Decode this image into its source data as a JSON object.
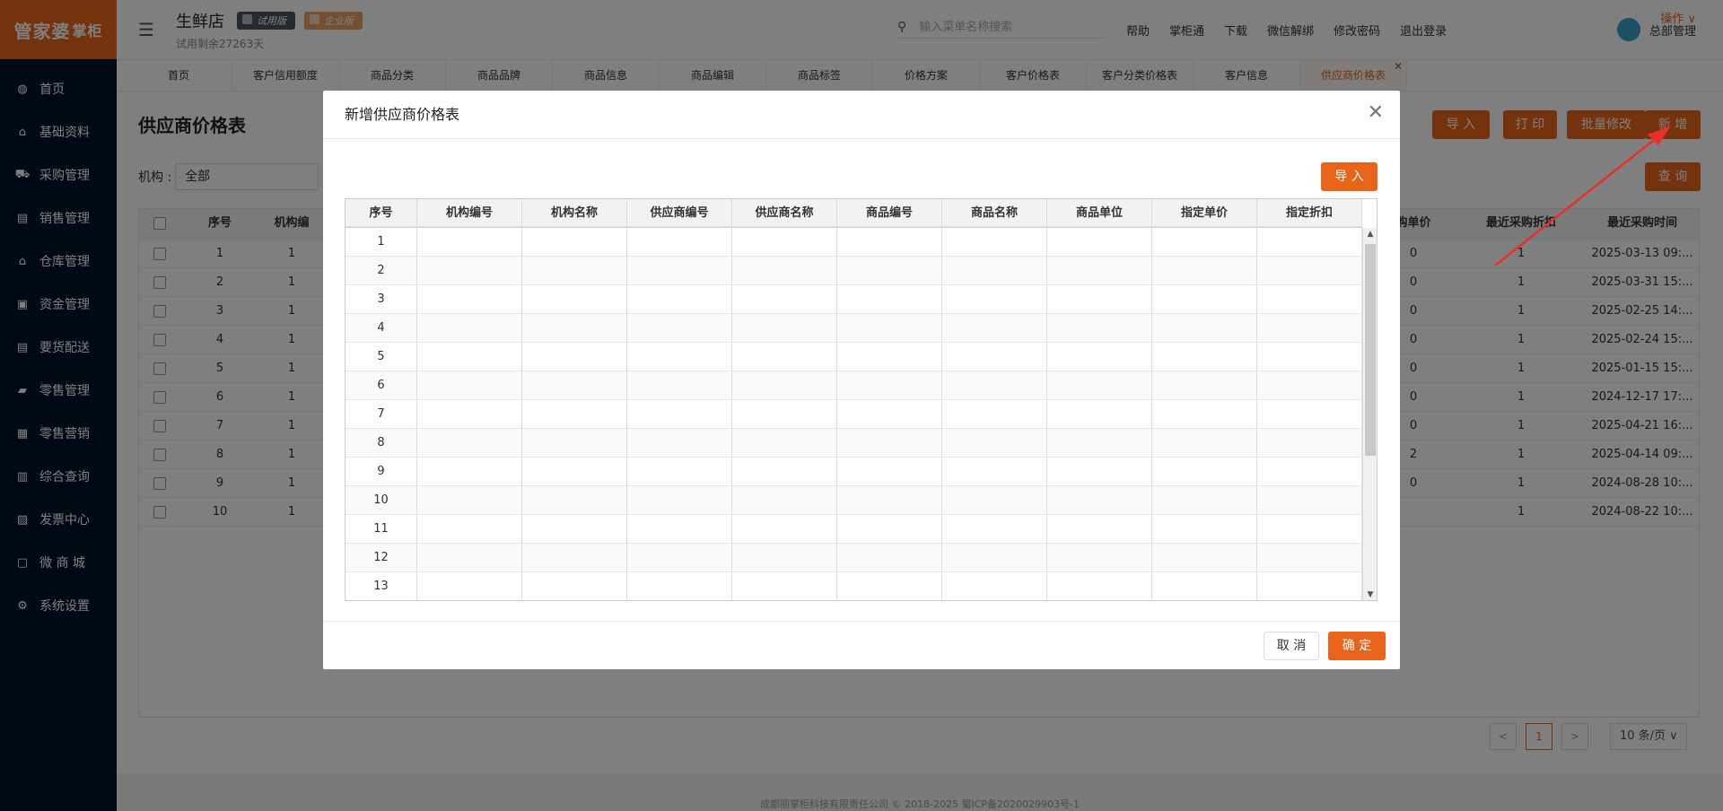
{
  "logo": {
    "main": "管家婆",
    "sub": "掌柜"
  },
  "sidebar": {
    "items": [
      {
        "label": "首页",
        "icon": "globe-icon"
      },
      {
        "label": "基础资料",
        "icon": "home-icon"
      },
      {
        "label": "采购管理",
        "icon": "cart-icon"
      },
      {
        "label": "销售管理",
        "icon": "sale-icon"
      },
      {
        "label": "仓库管理",
        "icon": "warehouse-icon"
      },
      {
        "label": "资金管理",
        "icon": "money-icon"
      },
      {
        "label": "要货配送",
        "icon": "delivery-icon"
      },
      {
        "label": "零售管理",
        "icon": "chart-icon"
      },
      {
        "label": "零售营销",
        "icon": "gift-icon"
      },
      {
        "label": "综合查询",
        "icon": "bar-chart-icon"
      },
      {
        "label": "发票中心",
        "icon": "invoice-icon"
      },
      {
        "label": "微 商 城",
        "icon": "shop-icon"
      },
      {
        "label": "系统设置",
        "icon": "gear-icon"
      }
    ]
  },
  "header": {
    "store_name": "生鲜店",
    "badge_trial": "试用版",
    "badge_edition": "企业版",
    "trial_left": "试用剩余27263天",
    "search_placeholder": "输入菜单名称搜索",
    "links": [
      "帮助",
      "掌柜通",
      "下载",
      "微信解绑",
      "修改密码",
      "退出登录"
    ],
    "user": "总部管理"
  },
  "tabs": {
    "items": [
      "首页",
      "客户信用额度",
      "商品分类",
      "商品品牌",
      "商品信息",
      "商品编辑",
      "商品标签",
      "价格方案",
      "客户价格表",
      "客户分类价格表",
      "客户信息",
      "供应商价格表"
    ],
    "active_index": 11,
    "ops_label": "操作 ∨"
  },
  "page": {
    "title": "供应商价格表",
    "buttons": {
      "import": "导 入",
      "print": "打 印",
      "batch_edit": "批量修改",
      "add": "新 增",
      "query": "查 询"
    },
    "filter_label": "机构 :",
    "filter_value": "全部",
    "table": {
      "headers": {
        "seq": "序号",
        "org": "机构编",
        "last_price": "购单价",
        "last_discount": "最近采购折扣",
        "last_time": "最近采购时间"
      },
      "rows": [
        {
          "seq": "1",
          "org": "1",
          "price": "0",
          "discount": "1",
          "time": "2025-03-13 09:..."
        },
        {
          "seq": "2",
          "org": "1",
          "price": "0",
          "discount": "1",
          "time": "2025-03-31 15:..."
        },
        {
          "seq": "3",
          "org": "1",
          "price": "0",
          "discount": "1",
          "time": "2025-02-25 14:..."
        },
        {
          "seq": "4",
          "org": "1",
          "price": "0",
          "discount": "1",
          "time": "2025-02-24 15:..."
        },
        {
          "seq": "5",
          "org": "1",
          "price": "0",
          "discount": "1",
          "time": "2025-01-15 15:..."
        },
        {
          "seq": "6",
          "org": "1",
          "price": "0",
          "discount": "1",
          "time": "2024-12-17 17:..."
        },
        {
          "seq": "7",
          "org": "1",
          "price": "0",
          "discount": "1",
          "time": "2025-04-21 16:..."
        },
        {
          "seq": "8",
          "org": "1",
          "price": "2",
          "discount": "1",
          "time": "2025-04-14 09:..."
        },
        {
          "seq": "9",
          "org": "1",
          "price": "0",
          "discount": "1",
          "time": "2024-08-28 10:..."
        },
        {
          "seq": "10",
          "org": "1",
          "price": "",
          "discount": "1",
          "time": "2024-08-22 10:..."
        }
      ]
    },
    "pager": {
      "prev": "<",
      "current": "1",
      "next": ">",
      "size": "10 条/页 ∨"
    },
    "footer": "成都丽掌柜科技有限责任公司 © 2018-2025 蜀ICP备2020029903号-1"
  },
  "modal": {
    "title": "新增供应商价格表",
    "import_label": "导 入",
    "columns": [
      "序号",
      "机构编号",
      "机构名称",
      "供应商编号",
      "供应商名称",
      "商品编号",
      "商品名称",
      "商品单位",
      "指定单价",
      "指定折扣"
    ],
    "row_numbers": [
      "1",
      "2",
      "3",
      "4",
      "5",
      "6",
      "7",
      "8",
      "9",
      "10",
      "11",
      "12",
      "13"
    ],
    "cancel_label": "取 消",
    "confirm_label": "确 定"
  }
}
